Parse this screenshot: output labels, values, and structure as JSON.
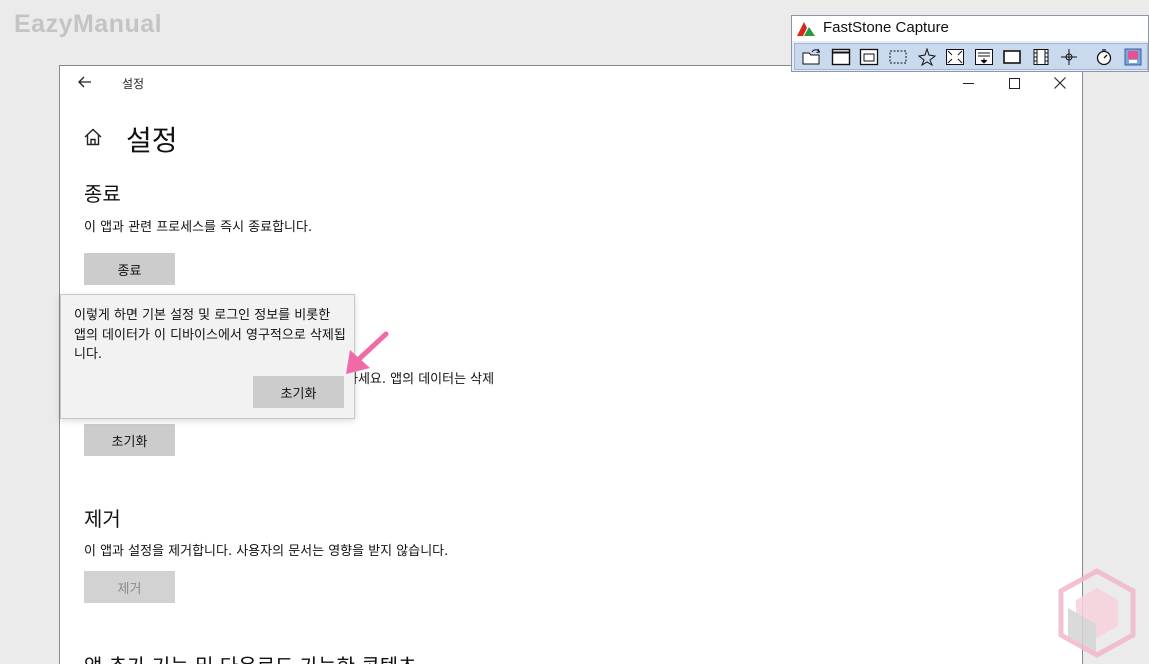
{
  "watermark": {
    "text": "EazyManual"
  },
  "window": {
    "title": "설정",
    "heading": "설정"
  },
  "sections": {
    "terminate": {
      "title": "종료",
      "desc": "이 앱과 관련 프로세스를 즉시 종료합니다.",
      "button": "종료"
    },
    "reset": {
      "desc_partial": "하세요. 앱의 데이터는 삭제",
      "button": "초기화"
    },
    "uninstall": {
      "title": "제거",
      "desc": "이 앱과 설정을 제거합니다. 사용자의 문서는 영향을 받지 않습니다.",
      "button": "제거"
    },
    "addons": {
      "title": "앱 추가 기능 및 다운로드 가능한 콘텐츠"
    }
  },
  "flyout": {
    "text": "이렇게 하면 기본 설정 및 로그인 정보를 비롯한 앱의 데이터가 이 디바이스에서 영구적으로 삭제됩니다.",
    "button": "초기화"
  },
  "faststone": {
    "title": "FastStone Capture",
    "tools": [
      "open-icon",
      "capture-window-icon",
      "capture-object-icon",
      "capture-rectangle-icon",
      "capture-freehand-icon",
      "capture-fullscreen-icon",
      "capture-scrolling-icon",
      "capture-fixed-region-icon",
      "screen-recorder-icon",
      "crosshair-icon",
      "timer-icon",
      "output-icon"
    ]
  },
  "colors": {
    "accent_arrow": "#f06aa8",
    "button_bg": "#cccccc",
    "toolbar_bg": "#c9d9ee"
  }
}
